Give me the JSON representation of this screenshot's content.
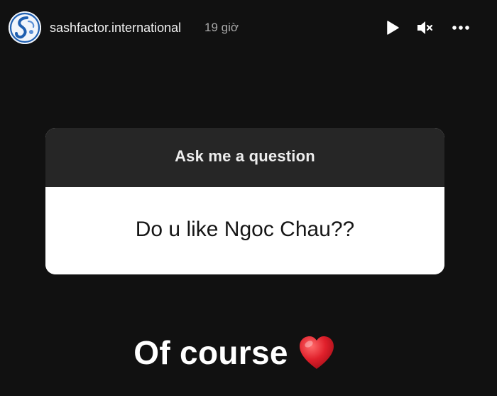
{
  "story_header": {
    "username": "sashfactor.international",
    "time_ago": "19 giờ",
    "avatar_icon": "sashfactor-logo",
    "controls": {
      "play_icon": "play-icon",
      "mute_icon": "muted-speaker-icon",
      "more_icon": "more-options-icon"
    }
  },
  "question_sticker": {
    "title": "Ask me a question",
    "question": "Do u like Ngoc Chau??"
  },
  "answer": {
    "text": "Of course",
    "emoji_icon": "red-heart-icon"
  },
  "colors": {
    "background": "#111111",
    "sticker_header": "#262626",
    "sticker_body": "#ffffff",
    "heart": "#e0202b",
    "brand_blue": "#1f5fb0"
  }
}
